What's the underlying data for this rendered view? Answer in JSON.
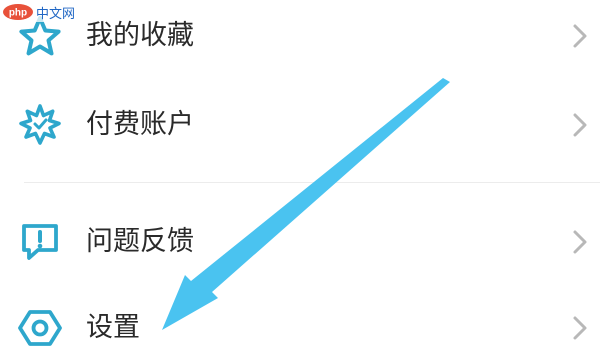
{
  "watermark": {
    "logo_text": "php",
    "text": "中文网"
  },
  "menu": {
    "items": [
      {
        "label": "我的收藏",
        "icon": "star-icon"
      },
      {
        "label": "付费账户",
        "icon": "badge-burst-icon"
      },
      {
        "label": "问题反馈",
        "icon": "feedback-exclamation-icon"
      },
      {
        "label": "设置",
        "icon": "gear-hexagon-icon"
      }
    ]
  },
  "colors": {
    "icon_accent": "#2ea7cc",
    "arrow": "#4ac3f0",
    "label_text": "#2a2a2a",
    "chevron": "#b8b8b8",
    "divider": "#ececec"
  }
}
